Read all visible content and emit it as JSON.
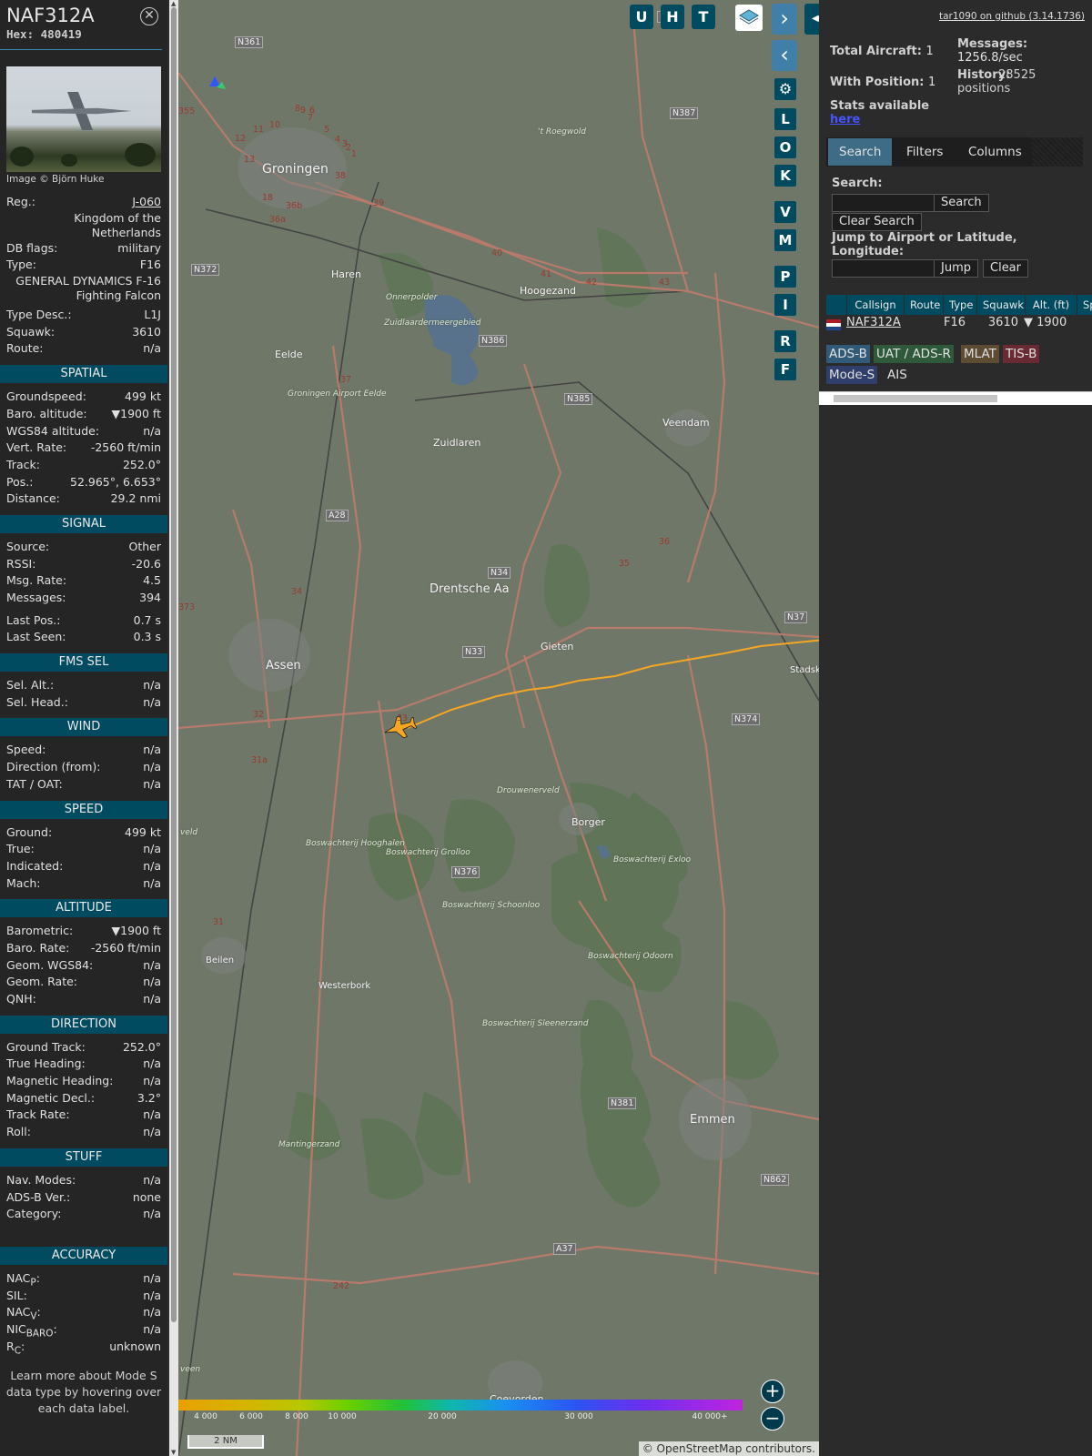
{
  "aircraft": {
    "callsign": "NAF312A",
    "hex_label": "Hex:",
    "hex": "480419",
    "image_credit": "Image © Björn Huke",
    "registration_label": "Reg.:",
    "registration": "J-060",
    "country": "Kingdom of the Netherlands",
    "dbflags_label": "DB flags:",
    "dbflags": "military",
    "type_label": "Type:",
    "type": "F16",
    "type_full": "GENERAL DYNAMICS F-16 Fighting Falcon",
    "type_desc_label": "Type Desc.:",
    "type_desc": "L1J",
    "squawk_label": "Squawk:",
    "squawk": "3610",
    "route_label": "Route:",
    "route": "n/a"
  },
  "sections": {
    "spatial": {
      "title": "SPATIAL",
      "rows": [
        {
          "label": "Groundspeed:",
          "value": "499 kt"
        },
        {
          "label": "Baro. altitude:",
          "value": "▼1900 ft"
        },
        {
          "label": "WGS84 altitude:",
          "value": "n/a"
        },
        {
          "label": "Vert. Rate:",
          "value": "-2560 ft/min"
        },
        {
          "label": "Track:",
          "value": "252.0°"
        },
        {
          "label": "Pos.:",
          "value": "52.965°, 6.653°"
        },
        {
          "label": "Distance:",
          "value": "29.2 nmi"
        }
      ]
    },
    "signal": {
      "title": "SIGNAL",
      "rows": [
        {
          "label": "Source:",
          "value": "Other"
        },
        {
          "label": "RSSI:",
          "value": "-20.6"
        },
        {
          "label": "Msg. Rate:",
          "value": "4.5"
        },
        {
          "label": "Messages:",
          "value": "394"
        },
        {
          "label": "Last Pos.:",
          "value": "0.7 s"
        },
        {
          "label": "Last Seen:",
          "value": "0.3 s"
        }
      ]
    },
    "fms": {
      "title": "FMS SEL",
      "rows": [
        {
          "label": "Sel. Alt.:",
          "value": "n/a"
        },
        {
          "label": "Sel. Head.:",
          "value": "n/a"
        }
      ]
    },
    "wind": {
      "title": "WIND",
      "rows": [
        {
          "label": "Speed:",
          "value": "n/a"
        },
        {
          "label": "Direction (from):",
          "value": "n/a"
        },
        {
          "label": "TAT / OAT:",
          "value": "n/a"
        }
      ]
    },
    "speed": {
      "title": "SPEED",
      "rows": [
        {
          "label": "Ground:",
          "value": "499 kt"
        },
        {
          "label": "True:",
          "value": "n/a"
        },
        {
          "label": "Indicated:",
          "value": "n/a"
        },
        {
          "label": "Mach:",
          "value": "n/a"
        }
      ]
    },
    "altitude": {
      "title": "ALTITUDE",
      "rows": [
        {
          "label": "Barometric:",
          "value": "▼1900 ft"
        },
        {
          "label": "Baro. Rate:",
          "value": "-2560 ft/min"
        },
        {
          "label": "Geom. WGS84:",
          "value": "n/a"
        },
        {
          "label": "Geom. Rate:",
          "value": "n/a"
        },
        {
          "label": "QNH:",
          "value": "n/a"
        }
      ]
    },
    "direction": {
      "title": "DIRECTION",
      "rows": [
        {
          "label": "Ground Track:",
          "value": "252.0°"
        },
        {
          "label": "True Heading:",
          "value": "n/a"
        },
        {
          "label": "Magnetic Heading:",
          "value": "n/a"
        },
        {
          "label": "Magnetic Decl.:",
          "value": "3.2°"
        },
        {
          "label": "Track Rate:",
          "value": "n/a"
        },
        {
          "label": "Roll:",
          "value": "n/a"
        }
      ]
    },
    "stuff": {
      "title": "STUFF",
      "rows": [
        {
          "label": "Nav. Modes:",
          "value": "n/a"
        },
        {
          "label": "ADS-B Ver.:",
          "value": "none"
        },
        {
          "label": "Category:",
          "value": "n/a"
        }
      ]
    },
    "accuracy": {
      "title": "ACCURACY",
      "rows": [
        {
          "label": "NAC",
          "sub": "P",
          "value": "n/a"
        },
        {
          "label": "SIL:",
          "sub": "",
          "value": "n/a"
        },
        {
          "label": "NAC",
          "sub": "V",
          "value": "n/a"
        },
        {
          "label": "NIC",
          "sub": "BARO",
          "value": "n/a"
        },
        {
          "label": "R",
          "sub": "C",
          "value": "unknown"
        }
      ]
    }
  },
  "info_footer": "Learn more about Mode S data type by hovering over each data label.",
  "map": {
    "top_buttons": [
      "U",
      "H",
      "T"
    ],
    "side_buttons": [
      "L",
      "O",
      "K",
      "V",
      "M",
      "P",
      "I",
      "R",
      "F"
    ],
    "places": [
      "Groningen",
      "Haren",
      "Hoogezand",
      "Eelde",
      "Groningen Airport Eelde",
      "Zuidlaren",
      "Veendam",
      "Onnerpolder",
      "Zuidlaardermeergebied",
      "'t Roegwold",
      "Drentsche Aa",
      "Gieten",
      "Assen",
      "Stadsk",
      "Drouwenerveld",
      "Borger",
      "Boswachterij Hooghalen",
      "Boswachterij Grolloo",
      "Boswachterij Schoonloo",
      "Boswachterij Exloo",
      "Boswachterij Odoorn",
      "Boswachterij Sleenerzand",
      "Beilen",
      "Westerbork",
      "Emmen",
      "Mantingerzand",
      "Coevorden",
      "veld",
      "veen"
    ],
    "road_labels": [
      "N361",
      "N387",
      "N372",
      "N386",
      "N385",
      "A28",
      "N34",
      "N33",
      "N374",
      "N376",
      "N381",
      "N862",
      "A37",
      "355",
      "373",
      "N37",
      "N3",
      "36",
      "35",
      "33",
      "32",
      "31",
      "34",
      "37",
      "38",
      "39",
      "40",
      "41",
      "42",
      "43",
      "10",
      "9",
      "8",
      "7",
      "6",
      "5",
      "4",
      "3",
      "2",
      "1",
      "11",
      "12",
      "13",
      "18",
      "36b",
      "36a",
      "242",
      "31a"
    ],
    "scale": "2 NM",
    "altitude_legend": [
      "4 000",
      "6 000",
      "8 000",
      "10 000",
      "20 000",
      "30 000",
      "40 000+"
    ],
    "attribution": "© OpenStreetMap contributors.",
    "track_color": "#f5a623"
  },
  "sidebar": {
    "github_link": "tar1090 on github (3.14.1736)",
    "total_aircraft_label": "Total Aircraft:",
    "total_aircraft": "1",
    "with_position_label": "With Position:",
    "with_position": "1",
    "messages_label": "Messages:",
    "messages_value": "1256.8/sec",
    "history_label": "History:",
    "history_value": "28525 positions",
    "stats_label": "Stats available",
    "stats_link": "here",
    "tabs": [
      "Search",
      "Filters",
      "Columns"
    ],
    "search_label": "Search:",
    "search_button": "Search",
    "clear_search_button": "Clear Search",
    "jump_label": "Jump to Airport or Latitude, Longitude:",
    "jump_button": "Jump",
    "clear_button": "Clear",
    "table_headers": [
      "Callsign",
      "Route",
      "Type",
      "Squawk",
      "Alt. (ft)",
      "Sp"
    ],
    "table_rows": [
      {
        "callsign": "NAF312A",
        "route": "",
        "type": "F16",
        "squawk": "3610",
        "alt": "▼ 1900"
      }
    ],
    "source_tags": [
      "ADS-B",
      "UAT / ADS-R",
      "MLAT",
      "TIS-B",
      "Mode-S",
      "AIS"
    ]
  }
}
